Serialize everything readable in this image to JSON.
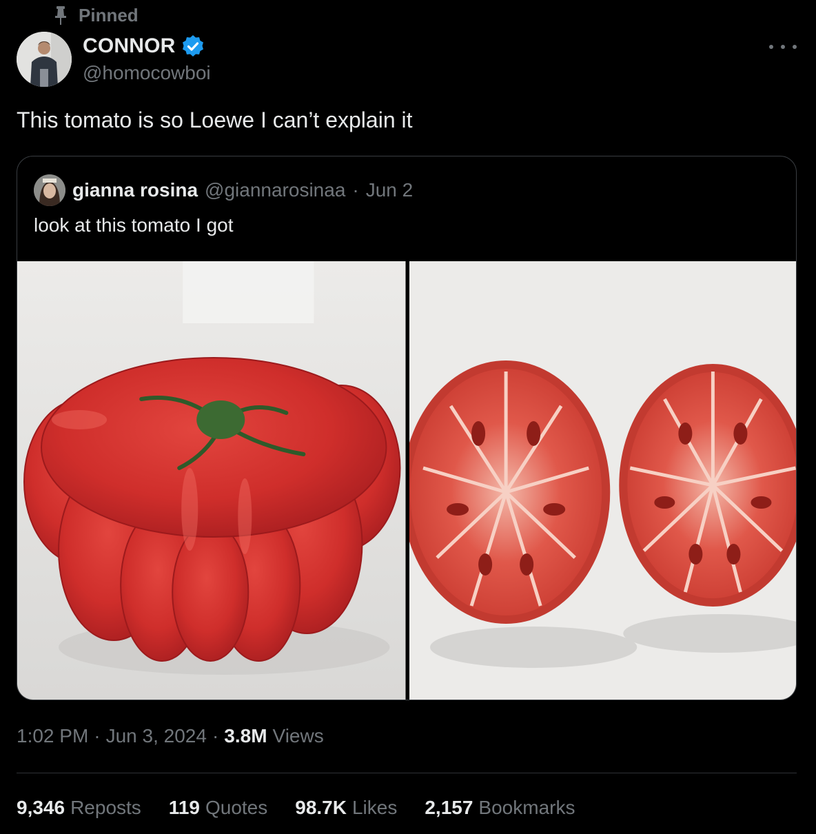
{
  "pinned": {
    "label": "Pinned"
  },
  "author": {
    "name": "CONNOR",
    "handle": "@homocowboi",
    "verified_color": "#1d9bf0"
  },
  "tweet": {
    "text": "This tomato is so Loewe I can’t explain it"
  },
  "quote": {
    "name": "gianna rosina",
    "handle": "@giannarosinaa",
    "separator": "·",
    "date": "Jun 2",
    "text": "look at this tomato I got"
  },
  "meta": {
    "time": "1:02 PM",
    "sep1": "·",
    "date": "Jun 3, 2024",
    "sep2": "·",
    "views_count": "3.8M",
    "views_label": "Views"
  },
  "stats": {
    "reposts_count": "9,346",
    "reposts_label": "Reposts",
    "quotes_count": "119",
    "quotes_label": "Quotes",
    "likes_count": "98.7K",
    "likes_label": "Likes",
    "bookmarks_count": "2,157",
    "bookmarks_label": "Bookmarks"
  },
  "icons": {
    "pin": "pin-icon",
    "verified": "verified-badge-icon",
    "more": "more-horizontal-icon"
  },
  "colors": {
    "background": "#000000",
    "text_primary": "#e7e9ea",
    "text_secondary": "#71767b",
    "border": "#2f3336"
  }
}
